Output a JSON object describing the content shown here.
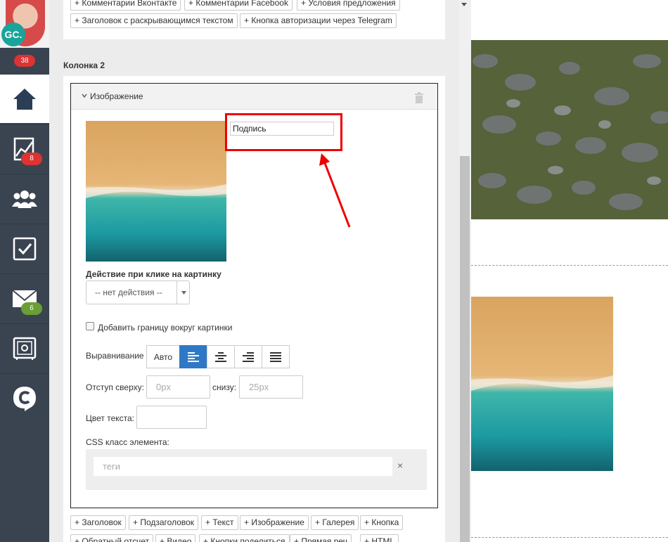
{
  "sidebar": {
    "avatar_initials": "GC.",
    "notifications_count": "38",
    "items": [
      {
        "icon": "home-icon",
        "badge": ""
      },
      {
        "icon": "sales-chart-icon",
        "badge": "8",
        "badge_color": "#d33"
      },
      {
        "icon": "users-icon",
        "badge": ""
      },
      {
        "icon": "tasks-checkbox-icon",
        "badge": ""
      },
      {
        "icon": "mail-icon",
        "badge": "6",
        "badge_color": "#6a9e36"
      },
      {
        "icon": "safe-icon",
        "badge": ""
      },
      {
        "icon": "getcourse-logo-icon",
        "badge": ""
      }
    ]
  },
  "top_blocks": [
    "+ Комментарии Вконтакте",
    "+ Комментарии Facebook",
    "+ Условия предложения",
    "+ Заголовок с раскрывающимся текстом",
    "+ Кнопка авторизации через Telegram"
  ],
  "column_label": "Колонка 2",
  "image_block": {
    "title": "Изображение",
    "caption_value": "Подпись",
    "click_action_label": "Действие при клике на картинку",
    "click_action_value": "-- нет действия --",
    "border_label": "Добавить границу вокруг картинки",
    "align_label": "Выравнивание",
    "align_auto": "Авто",
    "align_selected": "left",
    "margin_label": "Отступ сверху:",
    "margin_top_placeholder": "0px",
    "margin_bottom_label": "снизу:",
    "margin_bottom_placeholder": "25px",
    "text_color_label": "Цвет текста:",
    "css_label": "CSS класс элемента:",
    "tags_placeholder": "теги",
    "tags_clear": "×"
  },
  "bottom_blocks": [
    "+ Заголовок",
    "+ Подзаголовок",
    "+ Текст",
    "+ Изображение",
    "+ Галерея",
    "+ Кнопка",
    "+ Обратный отсчет",
    "+ Видео",
    "+ Кнопки поделиться",
    "+ Прямая реч",
    "+ HTML"
  ],
  "colors": {
    "sidebar_bg": "#3a4451",
    "accent_blue": "#2f78c6",
    "highlight_red": "#e00"
  }
}
